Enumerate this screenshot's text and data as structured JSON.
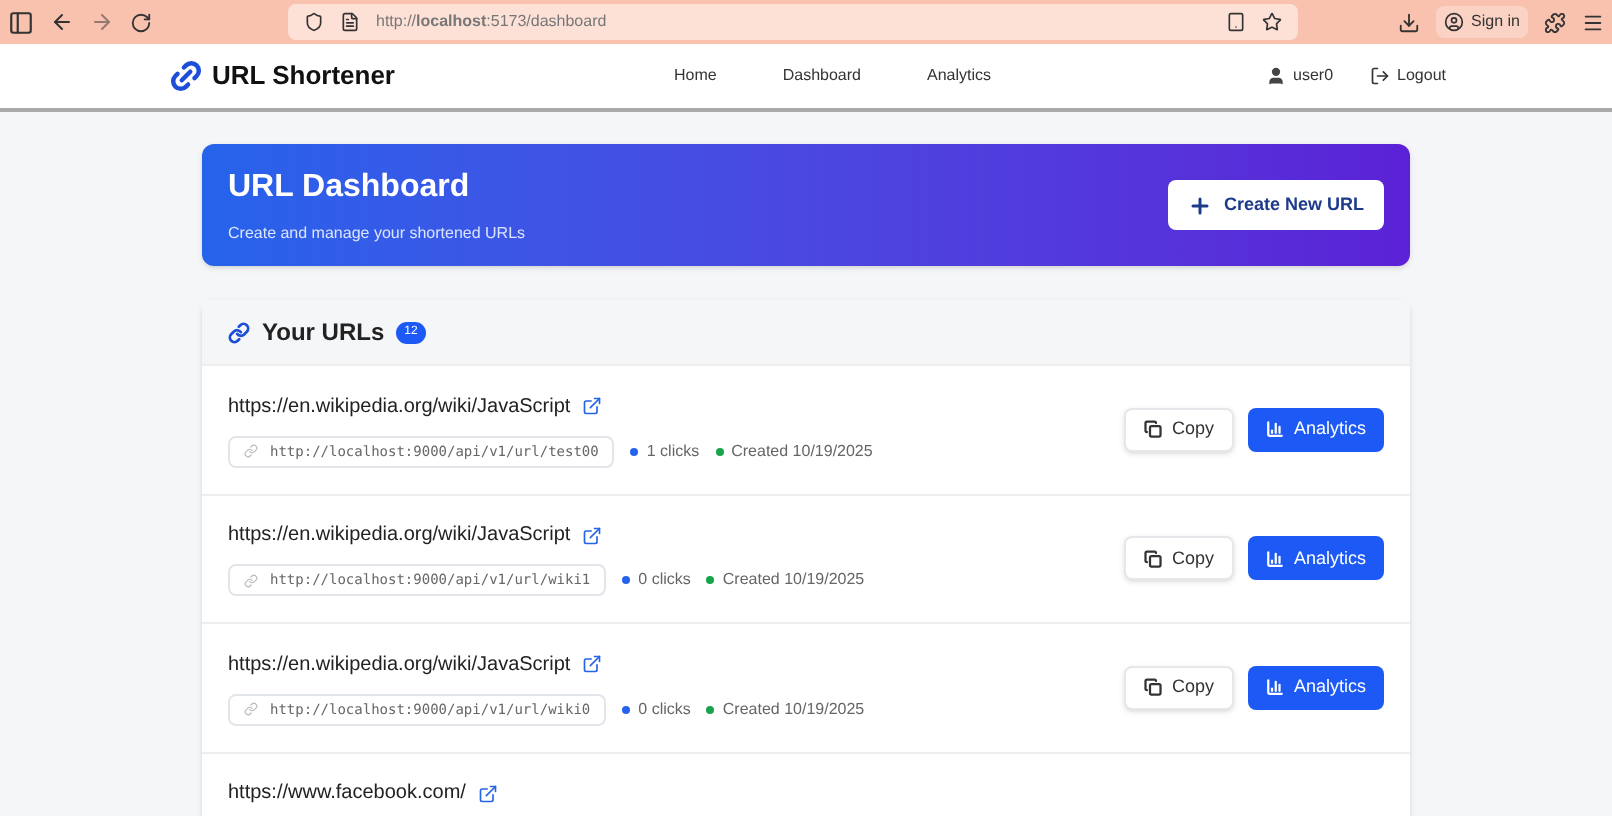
{
  "browser": {
    "address": "http://**localhost**:5173/dashboard",
    "sign_in": "Sign in"
  },
  "nav": {
    "brand": "URL Shortener",
    "links": [
      {
        "label": "Home"
      },
      {
        "label": "Dashboard"
      },
      {
        "label": "Analytics"
      }
    ],
    "user": "user0",
    "logout": "Logout"
  },
  "hero": {
    "title": "URL Dashboard",
    "subtitle": "Create and manage your shortened URLs",
    "button": "Create New URL"
  },
  "urls": {
    "title": "Your URLs",
    "count": "12",
    "items": [
      {
        "original": "https://en.wikipedia.org/wiki/JavaScript",
        "short": "http://localhost:9000/api/v1/url/test00",
        "clicks": "1 clicks",
        "created": "Created 10/19/2025",
        "copy": "Copy",
        "analytics": "Analytics"
      },
      {
        "original": "https://en.wikipedia.org/wiki/JavaScript",
        "short": "http://localhost:9000/api/v1/url/wiki1",
        "clicks": "0 clicks",
        "created": "Created 10/19/2025",
        "copy": "Copy",
        "analytics": "Analytics"
      },
      {
        "original": "https://en.wikipedia.org/wiki/JavaScript",
        "short": "http://localhost:9000/api/v1/url/wiki0",
        "clicks": "0 clicks",
        "created": "Created 10/19/2025",
        "copy": "Copy",
        "analytics": "Analytics"
      },
      {
        "original": "https://www.facebook.com/"
      }
    ]
  }
}
